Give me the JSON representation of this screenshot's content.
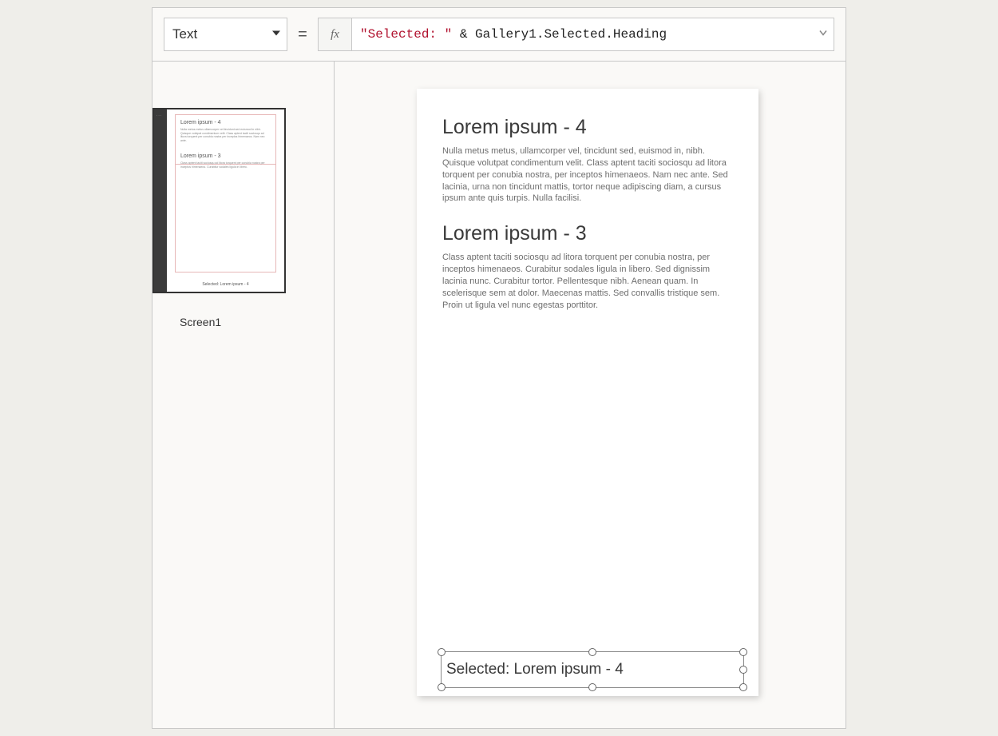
{
  "toolbar": {
    "property": "Text",
    "fx_label": "fx",
    "formula_string": "\"Selected: \"",
    "formula_operator": " & ",
    "formula_reference": "Gallery1.Selected.Heading"
  },
  "left_panel": {
    "screen_label": "Screen1",
    "thumb_more": "...",
    "thumb": {
      "h1": "Lorem ipsum - 4",
      "h2": "Lorem ipsum - 3",
      "footer": "Selected: Lorem ipsum - 4"
    }
  },
  "canvas": {
    "gallery": [
      {
        "heading": "Lorem ipsum - 4",
        "body": "Nulla metus metus, ullamcorper vel, tincidunt sed, euismod in, nibh. Quisque volutpat condimentum velit. Class aptent taciti sociosqu ad litora torquent per conubia nostra, per inceptos himenaeos. Nam nec ante. Sed lacinia, urna non tincidunt mattis, tortor neque adipiscing diam, a cursus ipsum ante quis turpis. Nulla facilisi."
      },
      {
        "heading": "Lorem ipsum - 3",
        "body": "Class aptent taciti sociosqu ad litora torquent per conubia nostra, per inceptos himenaeos. Curabitur sodales ligula in libero. Sed dignissim lacinia nunc. Curabitur tortor. Pellentesque nibh. Aenean quam. In scelerisque sem at dolor. Maecenas mattis. Sed convallis tristique sem. Proin ut ligula vel nunc egestas porttitor."
      }
    ],
    "selected_label": "Selected: Lorem ipsum - 4"
  }
}
